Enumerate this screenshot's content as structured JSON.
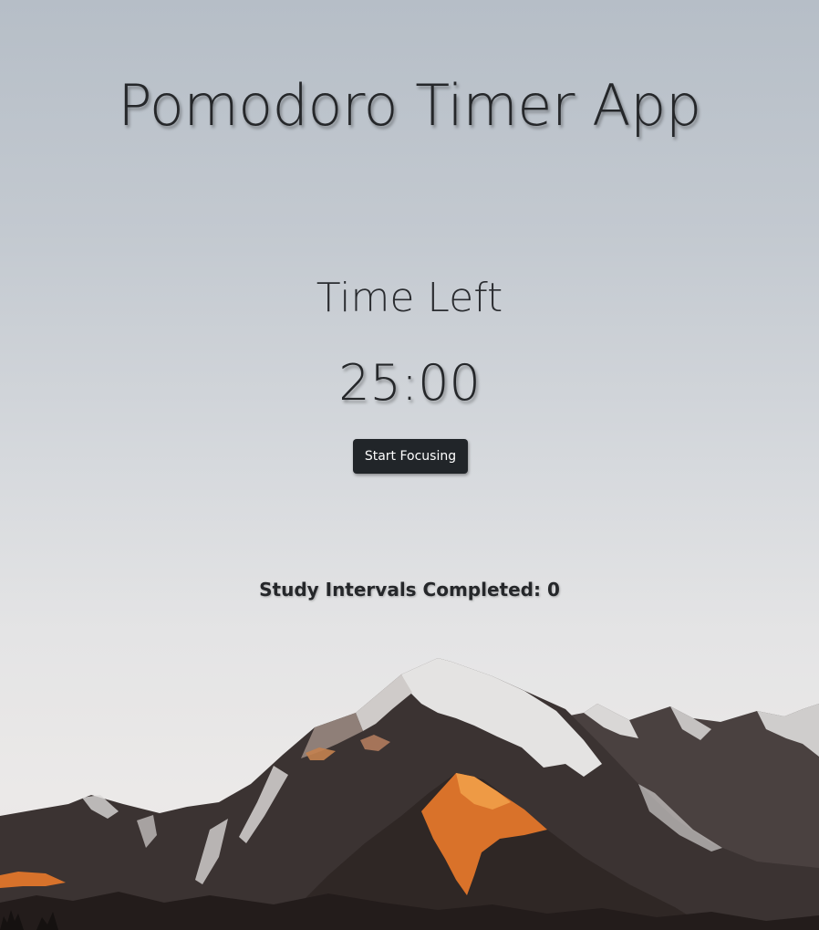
{
  "app": {
    "title": "Pomodoro Timer App"
  },
  "timer": {
    "label": "Time Left",
    "display": "25:00"
  },
  "controls": {
    "start_label": "Start Focusing"
  },
  "stats": {
    "intervals_label": "Study Intervals Completed: ",
    "intervals_count": "0"
  },
  "colors": {
    "button_bg": "#212529",
    "button_text": "#ffffff",
    "text": "#25272a",
    "mountain_highlight": "#e07a26"
  }
}
